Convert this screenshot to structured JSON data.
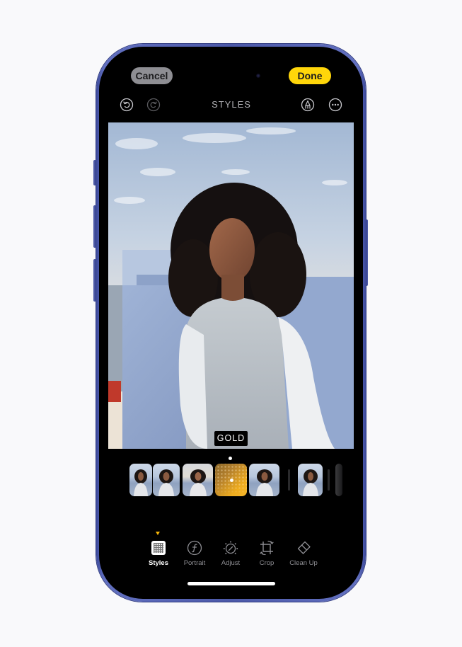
{
  "top_bar": {
    "cancel_label": "Cancel",
    "done_label": "Done",
    "title": "STYLES",
    "icons": [
      "undo-icon",
      "redo-icon",
      "markup-icon",
      "more-icon"
    ]
  },
  "photo": {
    "style_label": "GOLD"
  },
  "filmstrip": {
    "selected_index": 3,
    "items": [
      {
        "name": "style-thumb-1"
      },
      {
        "name": "style-thumb-2"
      },
      {
        "name": "style-thumb-3"
      },
      {
        "name": "style-thumb-gold",
        "label": "Gold"
      },
      {
        "name": "style-thumb-5"
      },
      {
        "name": "style-thumb-6"
      }
    ]
  },
  "toolbar": {
    "selected": "Styles",
    "items": [
      {
        "label": "Styles",
        "icon": "styles-grid-icon"
      },
      {
        "label": "Portrait",
        "icon": "portrait-f-icon"
      },
      {
        "label": "Adjust",
        "icon": "adjust-dial-icon"
      },
      {
        "label": "Crop",
        "icon": "crop-rotate-icon"
      },
      {
        "label": "Clean Up",
        "icon": "eraser-icon"
      }
    ]
  },
  "colors": {
    "accent": "#ffd60a",
    "selection_arrow": "#f5b50a",
    "frame": "#4c59a8",
    "cancel_bg": "#8e8e93"
  }
}
